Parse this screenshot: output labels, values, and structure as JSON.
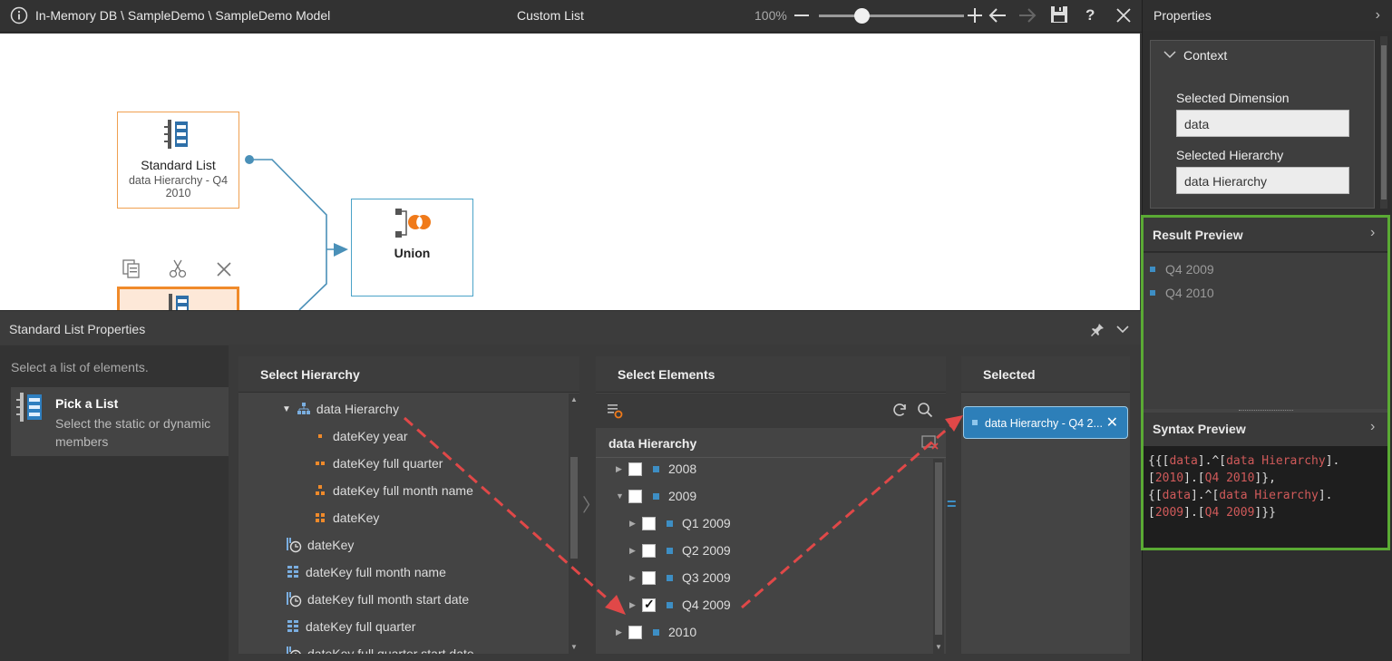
{
  "topbar": {
    "breadcrumb": "In-Memory DB \\ SampleDemo \\ SampleDemo Model",
    "title": "Custom List",
    "zoom": "100%",
    "zoom_level": 0.3
  },
  "canvas": {
    "standard_list": {
      "title": "Standard List",
      "subtitle": "data Hierarchy - Q4 2010"
    },
    "union": {
      "title": "Union"
    }
  },
  "bottom_panel": {
    "title": "Standard List Properties",
    "hint": "Select a list of elements.",
    "pick_list": {
      "title": "Pick a List",
      "description": "Select the static or dynamic members"
    }
  },
  "select_hierarchy": {
    "header": "Select Hierarchy",
    "items": [
      {
        "label": "data Hierarchy",
        "icon": "hierarchy-icon"
      },
      {
        "label": "dateKey year",
        "icon": "level-1-icon"
      },
      {
        "label": "dateKey full quarter",
        "icon": "level-2-icon"
      },
      {
        "label": "dateKey full month name",
        "icon": "level-3-icon"
      },
      {
        "label": "dateKey",
        "icon": "level-4-icon"
      },
      {
        "label": "dateKey",
        "icon": "date-clock-icon"
      },
      {
        "label": "dateKey full month name",
        "icon": "attribute-grid-icon"
      },
      {
        "label": "dateKey full month start date",
        "icon": "date-clock-icon"
      },
      {
        "label": "dateKey full quarter",
        "icon": "attribute-grid-icon"
      },
      {
        "label": "dateKey full quarter start date",
        "icon": "date-clock-icon"
      }
    ]
  },
  "select_elements": {
    "header": "Select Elements",
    "hierarchy_label": "data Hierarchy",
    "items": [
      {
        "label": "2008",
        "checked": false,
        "expanded": false
      },
      {
        "label": "2009",
        "checked": false,
        "expanded": true
      },
      {
        "label": "Q1 2009",
        "checked": false,
        "expanded": false
      },
      {
        "label": "Q2 2009",
        "checked": false,
        "expanded": false
      },
      {
        "label": "Q3 2009",
        "checked": false,
        "expanded": false
      },
      {
        "label": "Q4 2009",
        "checked": true,
        "expanded": false
      },
      {
        "label": "2010",
        "checked": false,
        "expanded": false
      }
    ]
  },
  "selected": {
    "header": "Selected",
    "chip": "data Hierarchy - Q4 2..."
  },
  "properties": {
    "header": "Properties",
    "context": {
      "title": "Context",
      "dimension_label": "Selected Dimension",
      "dimension_value": "data",
      "hierarchy_label": "Selected Hierarchy",
      "hierarchy_value": "data Hierarchy"
    }
  },
  "result_preview": {
    "header": "Result Preview",
    "items": [
      "Q4 2009",
      "Q4 2010"
    ]
  },
  "syntax_preview": {
    "header": "Syntax Preview",
    "lines": [
      [
        [
          "p",
          "{{["
        ],
        [
          "k",
          "data"
        ],
        [
          "p",
          "].^["
        ],
        [
          "k",
          "data Hierarchy"
        ],
        [
          "p",
          "]."
        ]
      ],
      [
        [
          "p",
          "["
        ],
        [
          "k",
          "2010"
        ],
        [
          "p",
          "].["
        ],
        [
          "k",
          "Q4 2010"
        ],
        [
          "p",
          "]},"
        ]
      ],
      [
        [
          "p",
          "{["
        ],
        [
          "k",
          "data"
        ],
        [
          "p",
          "].^["
        ],
        [
          "k",
          "data Hierarchy"
        ],
        [
          "p",
          "]."
        ]
      ],
      [
        [
          "p",
          "["
        ],
        [
          "k",
          "2009"
        ],
        [
          "p",
          "].["
        ],
        [
          "k",
          "Q4 2009"
        ],
        [
          "p",
          "]}}"
        ]
      ]
    ]
  },
  "colors": {
    "accent_blue": "#3d8ec4",
    "node_orange": "#f0a050",
    "highlight_green": "#5aaa34",
    "arrow_red": "#e04848"
  }
}
